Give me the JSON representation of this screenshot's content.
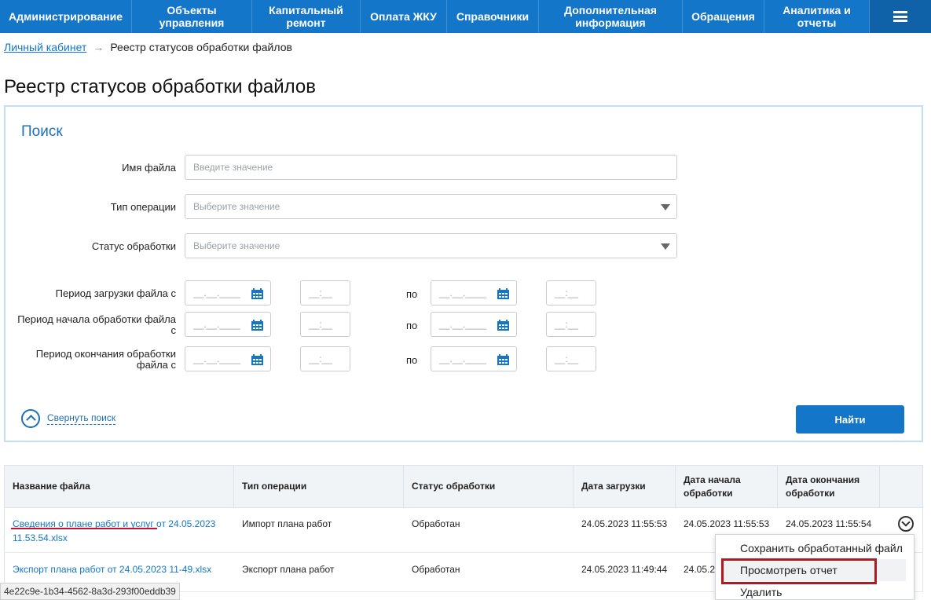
{
  "nav": {
    "items": [
      {
        "label": "Администрирование"
      },
      {
        "label": "Объекты управления"
      },
      {
        "label": "Капитальный ремонт"
      },
      {
        "label": "Оплата ЖКУ"
      },
      {
        "label": "Справочники"
      },
      {
        "label": "Дополнительная информация"
      },
      {
        "label": "Обращения"
      },
      {
        "label": "Аналитика и отчеты"
      }
    ],
    "menu_icon": "hamburger-icon"
  },
  "breadcrumb": {
    "home": "Личный кабинет",
    "separator": "→",
    "current": "Реестр статусов обработки файлов"
  },
  "page_title": "Реестр статусов обработки файлов",
  "search": {
    "title": "Поиск",
    "file_name_label": "Имя файла",
    "file_name_placeholder": "Введите значение",
    "operation_type_label": "Тип операции",
    "operation_type_placeholder": "Выберите значение",
    "status_label": "Статус обработки",
    "status_placeholder": "Выберите значение",
    "periods": [
      {
        "label": "Период загрузки файла с"
      },
      {
        "label": "Период начала обработки файла с"
      },
      {
        "label": "Период окончания обработки файла с"
      }
    ],
    "date_placeholder": "__.__.____",
    "time_placeholder": "__:__",
    "to_label": "по",
    "collapse_label": "Свернуть поиск",
    "find_button": "Найти"
  },
  "table": {
    "columns": [
      "Название файла",
      "Тип операции",
      "Статус обработки",
      "Дата загрузки",
      "Дата начала обработки",
      "Дата окончания обработки"
    ],
    "rows": [
      {
        "file_link": "Сведения о плане работ и услуг",
        "file_rest": " от 24.05.2023 11.53.54.xlsx",
        "operation": "Импорт плана работ",
        "status": "Обработан",
        "uploaded": "24.05.2023 11:55:53",
        "started": "24.05.2023 11:55:53",
        "finished": "24.05.2023 11:55:54"
      },
      {
        "file_link": "Экспорт плана работ от 24.05.2023 11-49.xlsx",
        "file_rest": "",
        "operation": "Экспорт плана работ",
        "status": "Обработан",
        "uploaded": "24.05.2023 11:49:44",
        "started": "24.05.2",
        "finished": ""
      }
    ]
  },
  "context_menu": {
    "items": [
      "Сохранить обработанный файл",
      "Просмотреть отчет",
      "Удалить"
    ]
  },
  "statusbar_text": "4e22c9e-1b34-4562-8a3d-293f00eddb39",
  "colors": {
    "primary": "#1376c8",
    "highlight_red": "#b01b22"
  }
}
